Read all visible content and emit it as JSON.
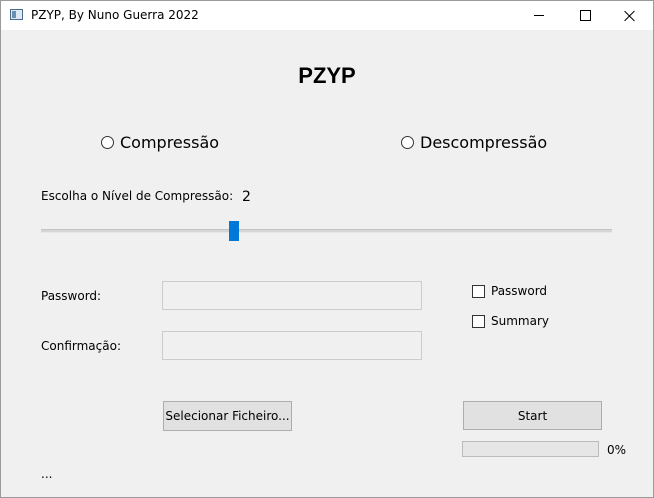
{
  "window": {
    "title": "PZYP, By Nuno Guerra 2022",
    "icon": "app-window-icon",
    "controls": {
      "minimize": "minimize-icon",
      "maximize": "maximize-icon",
      "close": "close-icon"
    }
  },
  "main": {
    "heading": "PZYP",
    "mode_options": [
      {
        "label": "Compressão",
        "selected": false
      },
      {
        "label": "Descompressão",
        "selected": false
      }
    ],
    "level": {
      "label": "Escolha o Nível de Compressão:",
      "value": "2"
    },
    "password_label": "Password:",
    "confirm_label": "Confirmação:",
    "password_value": "",
    "confirm_value": "",
    "checkboxes": [
      {
        "label": "Password",
        "checked": false
      },
      {
        "label": "Summary",
        "checked": false
      }
    ],
    "select_file_label": "Selecionar Ficheiro...",
    "start_label": "Start",
    "progress": {
      "percent_text": "0%",
      "fraction": 0
    },
    "status": "..."
  },
  "colors": {
    "accent": "#0078d7",
    "window_bg": "#f0f0f0",
    "button_bg": "#e1e1e1"
  }
}
